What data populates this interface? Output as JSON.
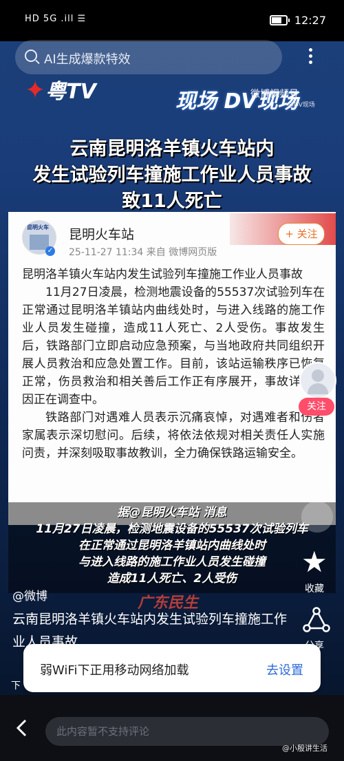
{
  "status_bar": {
    "carrier": "HD 5G .ill ☰",
    "time": "12:27"
  },
  "search": {
    "placeholder": "AI生成爆款特效"
  },
  "logos": {
    "gdtv": "粤TV",
    "dv": "现场 DV现场",
    "weibo_video": "微博视频号",
    "weibo_id": "@DV现场"
  },
  "headline": [
    "云南昆明洛羊镇火车站内",
    "发生试验列车撞施工作业人员事故",
    "致11人死亡"
  ],
  "post": {
    "author": "昆明火车站",
    "meta": "25-11-27 11:34  来自 微博网页版",
    "follow": "+ 关注",
    "title": "昆明洛羊镇火车站内发生试验列车撞施工作业人员事故",
    "para1": "11月27日凌晨，检测地震设备的55537次试验列车在正常通过昆明洛羊镇站内曲线处时，与进入线路的施工作业人员发生碰撞，造成11人死亡、2人受伤。事故发生后，铁路部门立即启动应急预案，与当地政府共同组织开展人员救治和应急处置工作。目前，该站运输秩序已恢复正常，伤员救治和相关善后工作正有序展开，事故详细原因正在调查中。",
    "para2": "铁路部门对遇难人员表示沉痛哀悼，对遇难者和伤者家属表示深切慰问。后续，将依法依规对相关责任人实施问责，并深刻吸取事故教训，全力确保铁路运输安全。"
  },
  "caption": [
    "据@昆明火车站 消息",
    "11月27日凌晨，检测地震设备的55537次试验列车",
    "在正常通过昆明洛羊镇站内曲线处时",
    "与进入线路的施工作业人员发生碰撞",
    "造成11人死亡、2人受伤"
  ],
  "gd_logo": "广东民生",
  "side": {
    "follow": "关注",
    "collect": "收藏",
    "share": "分享"
  },
  "video_info": {
    "author": "@微博",
    "description": "云南昆明洛羊镇火车站内发生试验列车撞施工作业人员事故"
  },
  "toast": {
    "text": "弱WiFi下正用移动网络加载",
    "action": "去设置",
    "under": "下"
  },
  "comment": {
    "placeholder": "此内容暂不支持评论"
  },
  "watermark": "@小殷讲生活"
}
